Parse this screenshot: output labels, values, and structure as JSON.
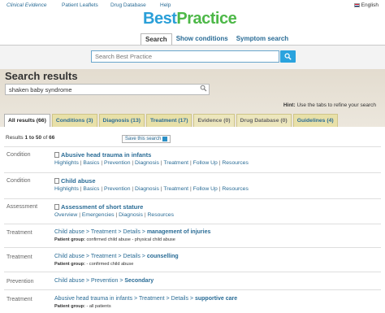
{
  "topnav": {
    "links": [
      "Clinical Evidence",
      "Patient Leaflets",
      "Drug Database",
      "Help"
    ],
    "language": "English"
  },
  "logo": {
    "part1": "Best",
    "part2": "Practice"
  },
  "search_tabs": [
    "Search",
    "Show conditions",
    "Symptom search"
  ],
  "search": {
    "placeholder": "Search Best Practice"
  },
  "results_header": {
    "title": "Search results",
    "query": "shaken baby syndrome",
    "hint_bold": "Hint:",
    "hint_text": " Use the tabs to refine your search"
  },
  "result_tabs": [
    "All results (66)",
    "Conditions (3)",
    "Diagnosis (13)",
    "Treatment (17)",
    "Evidence (0)",
    "Drug Database (0)",
    "Guidelines (4)"
  ],
  "results_count": {
    "prefix": "Results ",
    "range": "1 to 50",
    "mid": " of ",
    "total": "66"
  },
  "save_search": "Save this search",
  "colors": {
    "link": "#2a6c96",
    "accent": "#2aa3de",
    "tab_bg": "#e8e0a8",
    "header_bg": "#e3dccf"
  },
  "results": [
    {
      "type": "Condition",
      "title": "Abusive head trauma in infants",
      "links": [
        "Highlights",
        "Basics",
        "Prevention",
        "Diagnosis",
        "Treatment",
        "Follow Up",
        "Resources"
      ]
    },
    {
      "type": "Condition",
      "title": "Child abuse",
      "links": [
        "Highlights",
        "Basics",
        "Prevention",
        "Diagnosis",
        "Treatment",
        "Follow Up",
        "Resources"
      ]
    },
    {
      "type": "Assessment",
      "title": "Assessment of short stature",
      "links": [
        "Overview",
        "Emergencies",
        "Diagnosis",
        "Resources"
      ]
    },
    {
      "type": "Treatment",
      "path": "Child abuse > Treatment > Details > ",
      "target": "management of injuries",
      "patient_label": "Patient group:",
      "patient_group": " confirmed child abuse - physical child abuse"
    },
    {
      "type": "Treatment",
      "path": "Child abuse > Treatment > Details > ",
      "target": "counselling",
      "patient_label": "Patient group:",
      "patient_group": " - confirmed child abuse"
    },
    {
      "type": "Prevention",
      "path": "Child abuse > Prevention > ",
      "target": "Secondary"
    },
    {
      "type": "Treatment",
      "path": "Abusive head trauma in infants > Treatment > Details > ",
      "target": "supportive care",
      "patient_label": "Patient group:",
      "patient_group": " - all patients"
    }
  ]
}
